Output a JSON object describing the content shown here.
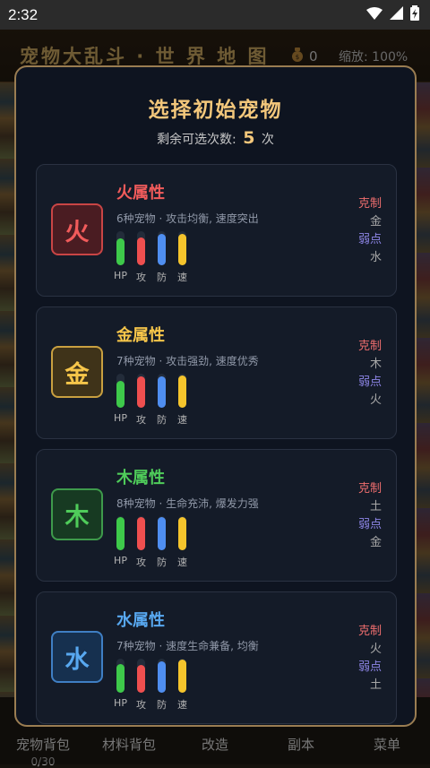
{
  "status_bar": {
    "time": "2:32"
  },
  "game": {
    "title": "宠物大乱斗 · 世 界 地 图",
    "coins": "0",
    "zoom": "缩放: 100%"
  },
  "bottom_nav": [
    {
      "label": "宠物背包",
      "sub": "0/30"
    },
    {
      "label": "材料背包",
      "sub": ""
    },
    {
      "label": "改造",
      "sub": ""
    },
    {
      "label": "副本",
      "sub": ""
    },
    {
      "label": "菜单",
      "sub": ""
    }
  ],
  "modal": {
    "title": "选择初始宠物",
    "remaining_prefix": "剩余可选次数:",
    "remaining_count": "5",
    "remaining_suffix": "次",
    "stat_labels": [
      "HP",
      "攻",
      "防",
      "速"
    ],
    "counter_label": "克制",
    "weak_label": "弱点",
    "elements": [
      {
        "glyph": "火",
        "name": "火属性",
        "description": "6种宠物 · 攻击均衡, 速度突出",
        "counter": "金",
        "weakness": "水",
        "accent": "#f15b5b",
        "badge_bg": "#4a1c22",
        "badge_border": "#c94545",
        "stats": [
          0.78,
          0.82,
          0.92,
          0.92
        ]
      },
      {
        "glyph": "金",
        "name": "金属性",
        "description": "7种宠物 · 攻击强劲, 速度优秀",
        "counter": "木",
        "weakness": "火",
        "accent": "#f7c64a",
        "badge_bg": "#3f3319",
        "badge_border": "#c9a040",
        "stats": [
          0.78,
          0.92,
          0.92,
          0.96
        ]
      },
      {
        "glyph": "木",
        "name": "木属性",
        "description": "8种宠物 · 生命充沛, 爆发力强",
        "counter": "土",
        "weakness": "金",
        "accent": "#4fcc5a",
        "badge_bg": "#173a22",
        "badge_border": "#3e9a4b",
        "stats": [
          0.97,
          0.97,
          0.97,
          0.97
        ]
      },
      {
        "glyph": "水",
        "name": "水属性",
        "description": "7种宠物 · 速度生命兼备, 均衡",
        "counter": "火",
        "weakness": "土",
        "accent": "#58a8f0",
        "badge_bg": "#16304f",
        "badge_border": "#3f7fc4",
        "stats": [
          0.85,
          0.82,
          0.92,
          0.97
        ]
      }
    ]
  },
  "colors": {
    "hp": "#3ec94a",
    "atk": "#ef4f4f",
    "def": "#4f8ef0",
    "spd": "#f5c42c",
    "modal_border": "#9a7d52",
    "title_gold": "#f3c77b"
  }
}
